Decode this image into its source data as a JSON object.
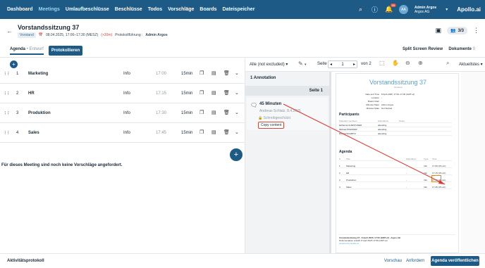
{
  "nav": {
    "items": [
      "Dashboard",
      "Meetings",
      "Umlaufbeschlüsse",
      "Beschlüsse",
      "Todos",
      "Vorschläge",
      "Boards",
      "Dateispeicher"
    ],
    "active": "Meetings",
    "notif_count": "99",
    "avatar_initials": "AA",
    "user_name": "Admin Argos",
    "user_org": "Argos AG",
    "brand": "Apollo.ai"
  },
  "header": {
    "title": "Vorstandssitzung 37",
    "status": "Vorstand",
    "date": "08.04.2025, 17:00–17:30 (MESZ)",
    "offset": "(+30m)",
    "lead_label": "Protokollführung :",
    "lead_name": "Admin Argos",
    "participants": "3/3"
  },
  "tabs": {
    "agenda": "Agenda",
    "agenda_sub": "• Entwurf",
    "protokoll": "Protokollieren",
    "split": "Split Screen Review",
    "docs": "Dokumente",
    "docs_count": "0"
  },
  "agenda_items": [
    {
      "num": "1",
      "name": "Marketing",
      "type": "Info",
      "time": "17:00",
      "duration": "15min"
    },
    {
      "num": "2",
      "name": "HR",
      "type": "Info",
      "time": "17:15",
      "duration": "15min"
    },
    {
      "num": "3",
      "name": "Produktion",
      "type": "Info",
      "time": "17:30",
      "duration": "15min"
    },
    {
      "num": "4",
      "name": "Sales",
      "type": "Info",
      "time": "17:45",
      "duration": "15min"
    }
  ],
  "no_suggestions": "Für dieses Meeting sind noch keine Vorschläge angefordert.",
  "viewer": {
    "filter": "Alle (not excluded)",
    "page_label": "Seite",
    "page": "1",
    "of_label": "von 2",
    "view": "Aktuellstes"
  },
  "annotations": {
    "header": "1 Annotation",
    "page": "Seite 1",
    "title": "45 Minuten",
    "author": "Andreas Schlatz, 8.4.2025",
    "visibility": "Schreibgeschützt",
    "copy": "Copy content"
  },
  "pdf": {
    "title": "Vorstandssitzung 37",
    "subtitle": "Vorstand",
    "meta": [
      {
        "k": "Date and Time",
        "v": "8 April 2025, 17:00–17:30 (GMT+2)"
      },
      {
        "k": "Location",
        "v": "-"
      },
      {
        "k": "Board Chair",
        "v": "-"
      },
      {
        "k": "Minutes Taker",
        "v": "Admin Argos"
      },
      {
        "k": "Minutes State",
        "v": "Not Started"
      }
    ],
    "participants_title": "Participants",
    "participants_head": [
      "Standard members",
      "Attendance",
      "Notes"
    ],
    "participants": [
      {
        "name": "katharina GUENTHNER",
        "status": "attending"
      },
      {
        "name": "Michael PFEIFFER",
        "status": "attending"
      },
      {
        "name": "Ronald SCHMITZ",
        "status": "attending"
      }
    ],
    "agenda_title": "Agenda",
    "agenda_head": [
      "#",
      "Title",
      "Submitted",
      "Type",
      "Time"
    ],
    "agenda_rows": [
      {
        "n": "1",
        "t": "Marketing",
        "s": "-",
        "ty": "Info",
        "tm": "17:00 (15 min)"
      },
      {
        "n": "2",
        "t": "HR",
        "s": "-",
        "ty": "Info",
        "tm": "17:15 (15 min)"
      },
      {
        "n": "3",
        "t": "Produktion",
        "s": "-",
        "ty": "Info",
        "tm": "17:30 (15 min)"
      },
      {
        "n": "4",
        "t": "Sales",
        "s": "-",
        "ty": "Info",
        "tm": "17:45 (15 min)"
      }
    ],
    "footer1": "Vorstandssitzung 37 · 8 April 2025, 17:00 (GMT+2) · Argos AG",
    "footer2": "Dokumentation erstellt: 8 April 2025 17:59 (GMT+2)",
    "footer3": "powered by Apollo.ai"
  },
  "footer": {
    "activity": "Aktivitätsprotokoll",
    "preview": "Vorschau",
    "request": "Anfordern",
    "publish": "Agenda veröffentlichen"
  }
}
